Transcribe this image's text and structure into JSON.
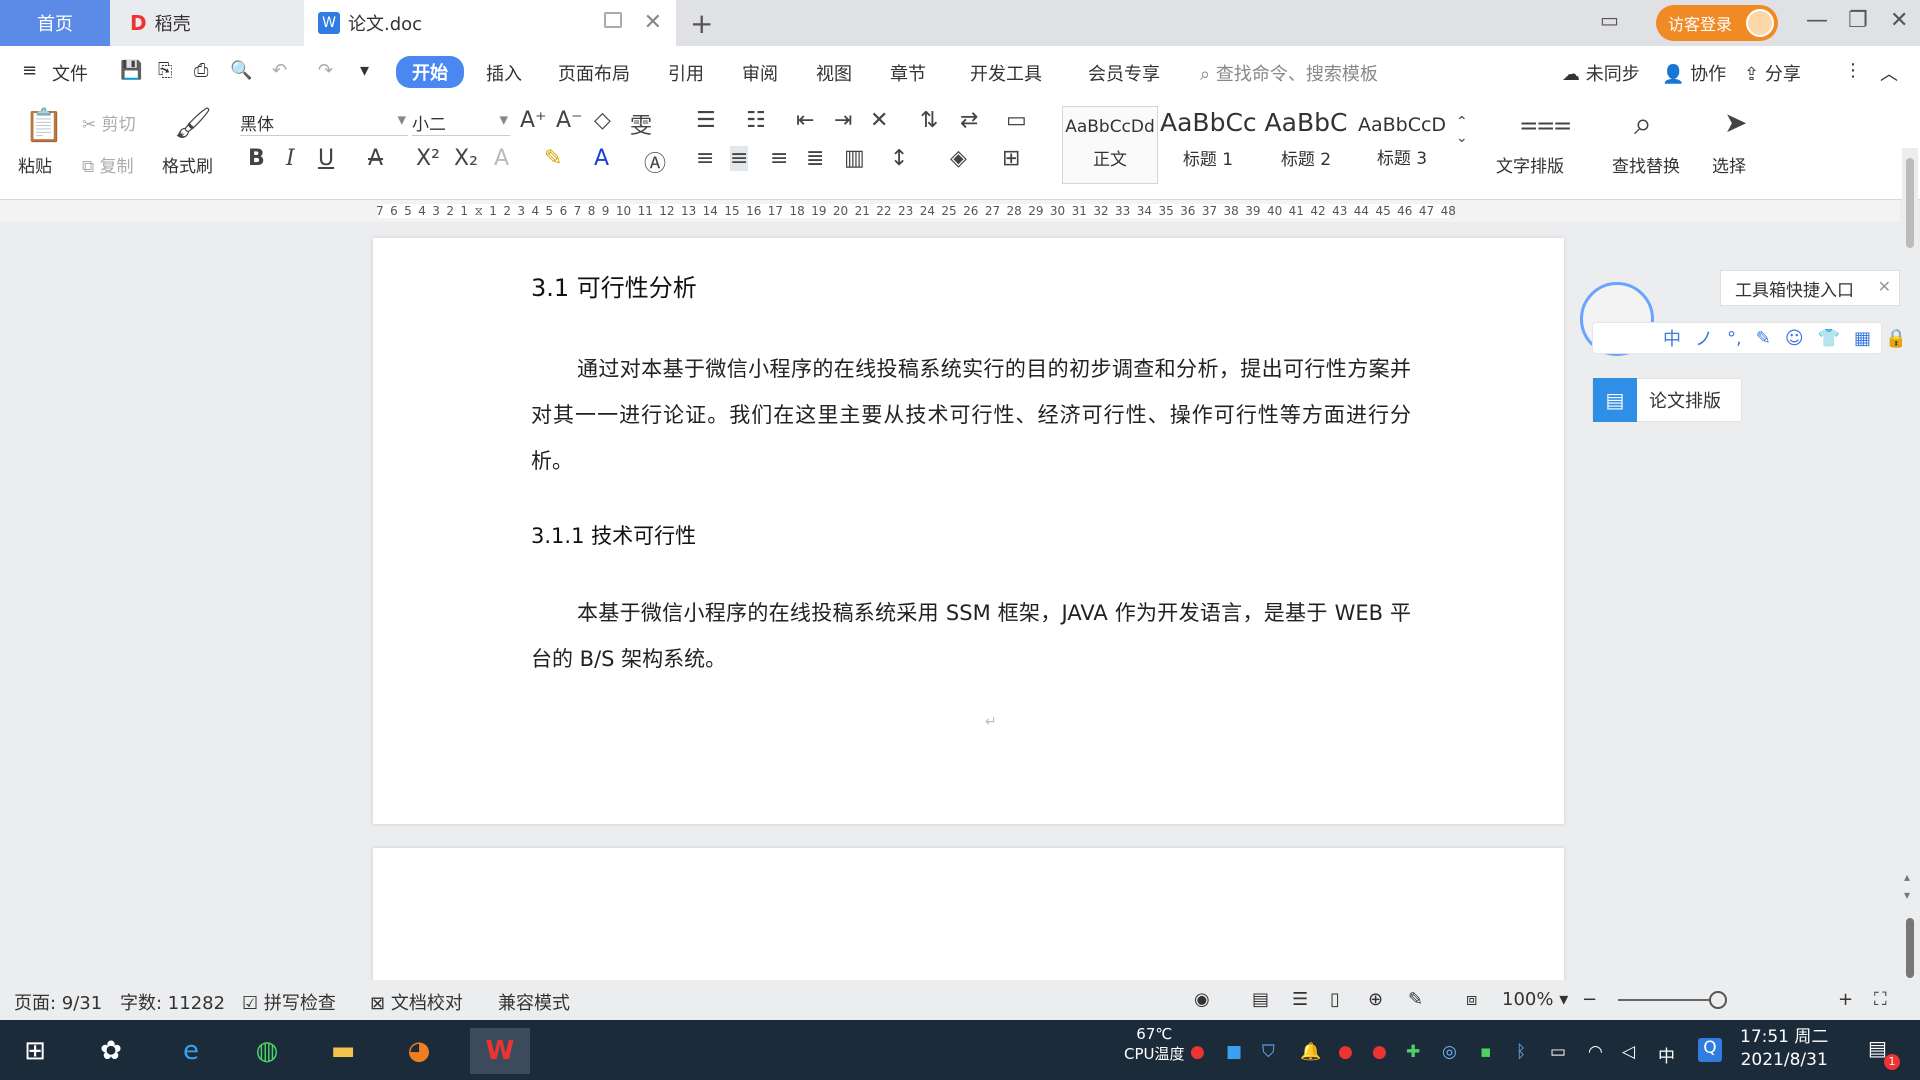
{
  "tabs": {
    "home": "首页",
    "daoke": "稻壳",
    "doc": "论文.doc"
  },
  "header": {
    "login": "访客登录"
  },
  "menu": {
    "file": "文件",
    "items": [
      "开始",
      "插入",
      "页面布局",
      "引用",
      "审阅",
      "视图",
      "章节",
      "开发工具",
      "会员专享"
    ],
    "search_cmd": "查找命令、搜索模板",
    "sync": "未同步",
    "collab": "协作",
    "share": "分享"
  },
  "ribbon": {
    "paste": "粘贴",
    "cut": "剪切",
    "copy": "复制",
    "format_painter": "格式刷",
    "font": "黑体",
    "size": "小二",
    "styles": [
      {
        "preview": "AaBbCcDd",
        "name": "正文"
      },
      {
        "preview": "AaBbCc",
        "name": "标题 1"
      },
      {
        "preview": "AaBbC",
        "name": "标题 2"
      },
      {
        "preview": "AaBbCcD",
        "name": "标题 3"
      }
    ],
    "text_layout": "文字排版",
    "find_replace": "查找替换",
    "select": "选择"
  },
  "ruler": {
    "ticks": [
      "7",
      "6",
      "5",
      "4",
      "3",
      "2",
      "1",
      "",
      "1",
      "2",
      "3",
      "4",
      "5",
      "6",
      "7",
      "8",
      "9",
      "10",
      "11",
      "12",
      "13",
      "14",
      "15",
      "16",
      "17",
      "18",
      "19",
      "20",
      "21",
      "22",
      "23",
      "24",
      "25",
      "26",
      "27",
      "28",
      "29",
      "30",
      "31",
      "32",
      "33",
      "34",
      "35",
      "36",
      "37",
      "38",
      "39",
      "40",
      "41",
      "42",
      "43",
      "44",
      "45",
      "46",
      "47",
      "48"
    ]
  },
  "document": {
    "heading1": "3.1 可行性分析",
    "para1": "通过对本基于微信小程序的在线投稿系统实行的目的初步调查和分析，提出可行性方案并对其一一进行论证。我们在这里主要从技术可行性、经济可行性、操作可行性等方面进行分析。",
    "heading2": "3.1.1 技术可行性",
    "para2": "本基于微信小程序的在线投稿系统采用 SSM 框架，JAVA 作为开发语言，是基于 WEB 平台的 B/S 架构系统。",
    "paragraph_mark": "↵"
  },
  "side_panel": {
    "toolbox": "工具箱快捷入口",
    "ime": [
      "中",
      "ノ",
      "°,",
      "✎",
      "☺",
      "👕",
      "▦",
      "🔒"
    ],
    "paper_layout": "论文排版"
  },
  "status": {
    "page": "页面: 9/31",
    "words": "字数: 11282",
    "spell": "拼写检查",
    "proof": "文档校对",
    "compat": "兼容模式",
    "zoom": "100%"
  },
  "taskbar": {
    "cpu_temp": "67℃",
    "cpu_label": "CPU温度",
    "ime": "中",
    "time": "17:51 周二",
    "date": "2021/8/31",
    "notify_count": "1"
  },
  "colors": {
    "accent": "#4a87f0",
    "login": "#f08a24",
    "taskbar": "#1c2b3a"
  }
}
